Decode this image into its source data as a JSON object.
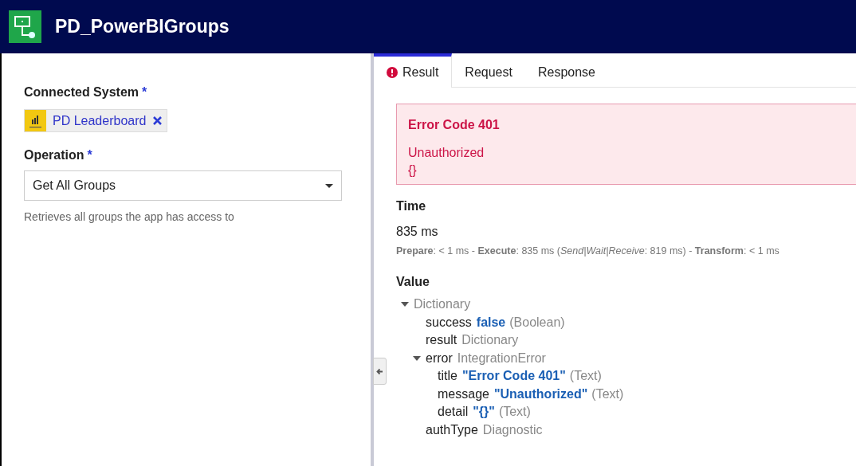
{
  "header": {
    "title": "PD_PowerBIGroups"
  },
  "form": {
    "connected_system": {
      "label": "Connected System",
      "required_mark": "*",
      "chip": "PD Leaderboard"
    },
    "operation": {
      "label": "Operation",
      "required_mark": "*",
      "value": "Get All Groups",
      "hint": "Retrieves all groups the app has access to"
    }
  },
  "tabs": [
    {
      "label": "Result",
      "selected": true,
      "error": true
    },
    {
      "label": "Request",
      "selected": false,
      "error": false
    },
    {
      "label": "Response",
      "selected": false,
      "error": false
    }
  ],
  "error_box": {
    "title": "Error Code 401",
    "message": "Unauthorized",
    "detail": "{}"
  },
  "time": {
    "heading": "Time",
    "total": "835 ms",
    "breakdown": "**Prepare**: < 1 ms - **Execute**: 835 ms (*Send|Wait|Receive*: 819 ms) - **Transform**: < 1 ms"
  },
  "value": {
    "heading": "Value",
    "tree": [
      {
        "value": "Dictionary",
        "kind": "type",
        "expanded": true,
        "children": [
          {
            "key": "success",
            "value": "false",
            "kind": "literal",
            "type_note": "(Boolean)"
          },
          {
            "key": "result",
            "value": "Dictionary",
            "kind": "type"
          },
          {
            "key": "error",
            "value": "IntegrationError",
            "kind": "type",
            "expanded": true,
            "children": [
              {
                "key": "title",
                "value": "\"Error Code 401\"",
                "kind": "literal",
                "type_note": "(Text)"
              },
              {
                "key": "message",
                "value": "\"Unauthorized\"",
                "kind": "literal",
                "type_note": "(Text)"
              },
              {
                "key": "detail",
                "value": "\"{}\"",
                "kind": "literal",
                "type_note": "(Text)"
              }
            ]
          },
          {
            "key": "authType",
            "value": "Diagnostic",
            "kind": "type"
          }
        ]
      }
    ]
  }
}
